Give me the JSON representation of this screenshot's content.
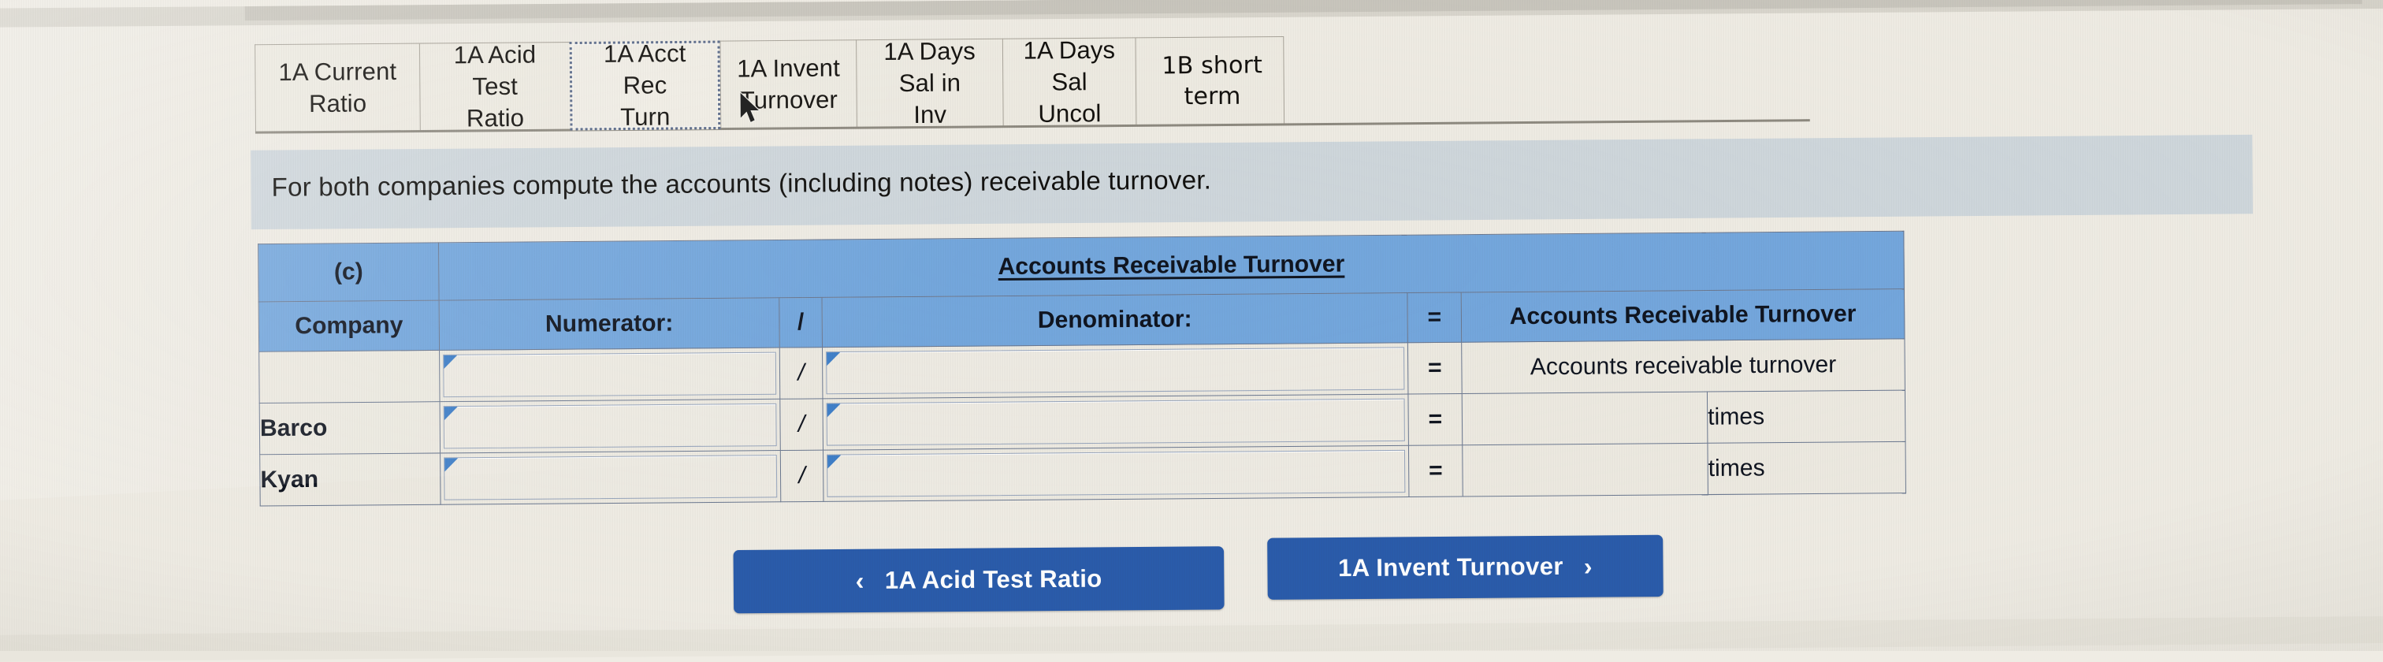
{
  "tabs": [
    {
      "id": "tab-1a-current-ratio",
      "line1": "1A Current",
      "line2": "Ratio",
      "selected": false
    },
    {
      "id": "tab-1a-acid-test-ratio",
      "line1": "1A Acid Test",
      "line2": "Ratio",
      "selected": false
    },
    {
      "id": "tab-1a-acct-rec-turn",
      "line1": "1A Acct Rec",
      "line2": "Turn",
      "selected": true
    },
    {
      "id": "tab-1a-invent-turnover",
      "line1": "1A Invent",
      "line2": "Turnover",
      "selected": false
    },
    {
      "id": "tab-1a-days-sal-in-inv",
      "line1": "1A Days Sal in",
      "line2": "Inv",
      "selected": false
    },
    {
      "id": "tab-1a-days-sal-uncol",
      "line1": "1A Days Sal",
      "line2": "Uncol",
      "selected": false
    },
    {
      "id": "tab-1b-short-term",
      "line1": "1B short term",
      "line2": "",
      "selected": false
    }
  ],
  "instruction": "For both companies compute the accounts (including notes) receivable turnover.",
  "table": {
    "part_label": "(c)",
    "title": "Accounts Receivable Turnover",
    "headers": {
      "company": "Company",
      "numerator": "Numerator:",
      "slash": "/",
      "denominator": "Denominator:",
      "equals": "=",
      "result": "Accounts Receivable Turnover"
    },
    "rows": [
      {
        "company": "",
        "numerator": "",
        "slash": "/",
        "denominator": "",
        "equals": "=",
        "result": "",
        "unit": "Accounts receivable turnover",
        "unit_spans_cell": true
      },
      {
        "company": "Barco",
        "numerator": "",
        "slash": "/",
        "denominator": "",
        "equals": "=",
        "result": "",
        "unit": "times",
        "unit_spans_cell": false
      },
      {
        "company": "Kyan",
        "numerator": "",
        "slash": "/",
        "denominator": "",
        "equals": "=",
        "result": "",
        "unit": "times",
        "unit_spans_cell": false
      }
    ]
  },
  "nav": {
    "prev_label": "1A Acid Test Ratio",
    "prev_chevron": "‹",
    "next_label": "1A Invent Turnover",
    "next_chevron": "›"
  },
  "colors": {
    "header_blue": "#74a7dd",
    "button_blue": "#2a5cab",
    "band_blue_grey": "#cfd7dc",
    "page_bg": "#efece4"
  }
}
